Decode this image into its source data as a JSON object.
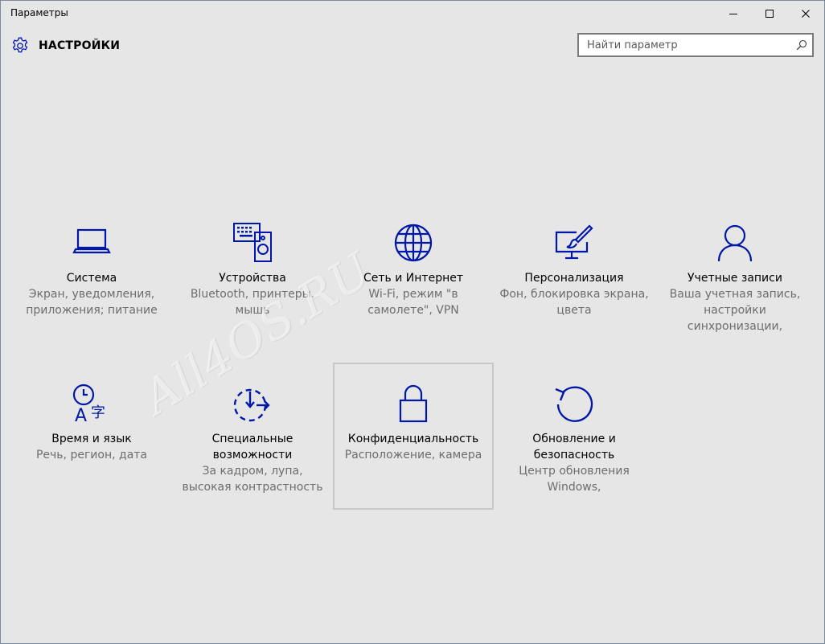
{
  "window": {
    "title": "Параметры"
  },
  "header": {
    "title": "НАСТРОЙКИ"
  },
  "search": {
    "placeholder": "Найти параметр"
  },
  "watermark": "All4OS.RU",
  "colors": {
    "accent": "#0018a8",
    "background": "#e6e6e6",
    "secondary_text": "#6d6d6d"
  },
  "tiles": [
    {
      "icon": "laptop-icon",
      "title": "Система",
      "desc": "Экран, уведомления, приложения; питание"
    },
    {
      "icon": "devices-icon",
      "title": "Устройства",
      "desc": "Bluetooth, принтеры, мышь"
    },
    {
      "icon": "globe-icon",
      "title": "Сеть и Интернет",
      "desc": "Wi-Fi, режим \"в самолете\", VPN"
    },
    {
      "icon": "personalization-icon",
      "title": "Персонализация",
      "desc": "Фон, блокировка экрана, цвета"
    },
    {
      "icon": "person-icon",
      "title": "Учетные записи",
      "desc": "Ваша учетная запись, настройки синхронизации,"
    },
    {
      "icon": "time-language-icon",
      "title": "Время и язык",
      "desc": "Речь, регион, дата"
    },
    {
      "icon": "ease-of-access-icon",
      "title": "Специальные возможности",
      "desc": "За кадром, лупа, высокая контрастность"
    },
    {
      "icon": "lock-icon",
      "title": "Конфиденциальность",
      "desc": "Расположение, камера"
    },
    {
      "icon": "update-icon",
      "title": "Обновление и безопасность",
      "desc": "Центр обновления Windows,"
    }
  ]
}
